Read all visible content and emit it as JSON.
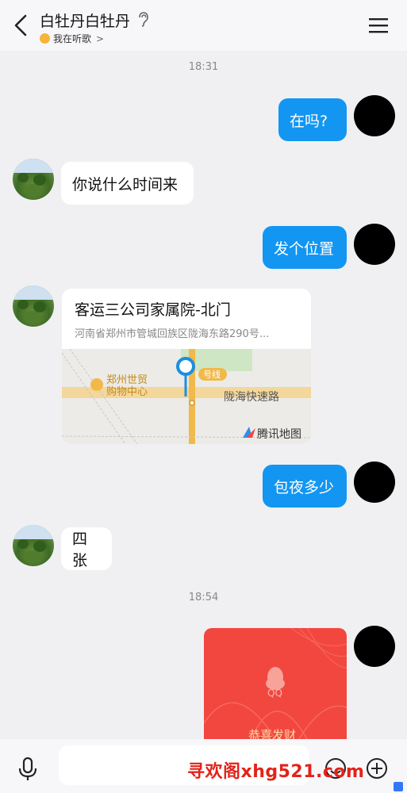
{
  "header": {
    "title": "白牡丹白牡丹",
    "status_text": "我在听歌",
    "status_chevron": ">"
  },
  "chat": {
    "time1": "18:31",
    "time2": "18:54",
    "messages": [
      {
        "from": "me",
        "text": "在吗?"
      },
      {
        "from": "other",
        "text": "你说什么时间来"
      },
      {
        "from": "me",
        "text": "发个位置"
      },
      {
        "from": "me",
        "text": "包夜多少"
      },
      {
        "from": "other",
        "text": "四张"
      }
    ],
    "location": {
      "title": "客运三公司家属院-北门",
      "address": "河南省郑州市管城回族区陇海东路290号...",
      "map_label_mall": "郑州世贸",
      "map_label_mall2": "购物中心",
      "map_label_road": "陇海快速路",
      "map_label_line": "号线",
      "map_brand": "腾讯地图"
    },
    "red_packet": {
      "logo": "QQ",
      "greeting": "恭喜发财"
    }
  },
  "input": {
    "placeholder": ""
  },
  "watermark": "寻欢阁xhg521.com",
  "colors": {
    "my_bubble": "#1296f2",
    "red_packet": "#f2473f",
    "background": "#f0f0f3"
  }
}
